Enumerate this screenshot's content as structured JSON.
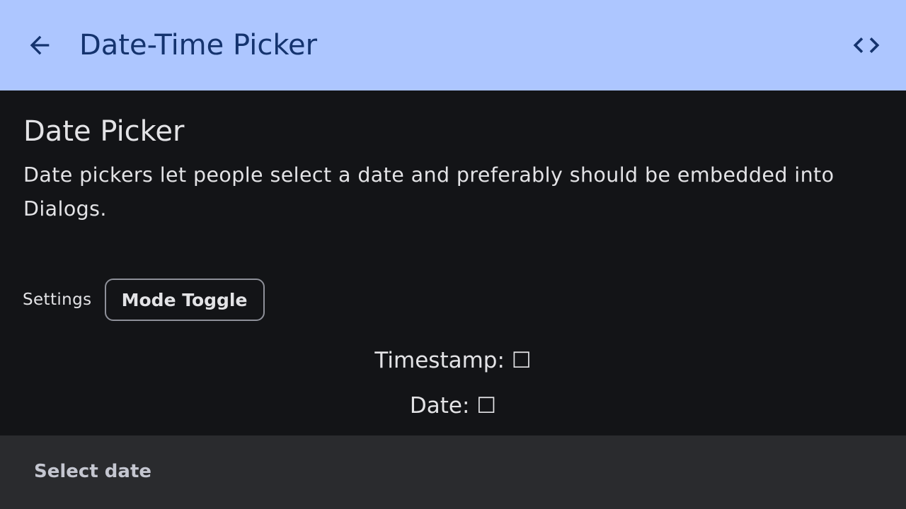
{
  "app_bar": {
    "title": "Date-Time Picker",
    "back_icon": "arrow-back-icon",
    "code_icon": "code-icon",
    "background": "#adc6ff",
    "foreground": "#14336e"
  },
  "section": {
    "title": "Date Picker",
    "description": "Date pickers let people select a date and preferably should be embedded into Dialogs."
  },
  "settings": {
    "label": "Settings",
    "mode_toggle_label": "Mode Toggle"
  },
  "values": {
    "timestamp": "Timestamp: ☐",
    "date": "Date: ☐"
  },
  "bottom_sheet": {
    "title": "Select date"
  },
  "colors": {
    "background": "#131417",
    "sheet_background": "#2a2b2e",
    "text": "#e3e3e6"
  }
}
